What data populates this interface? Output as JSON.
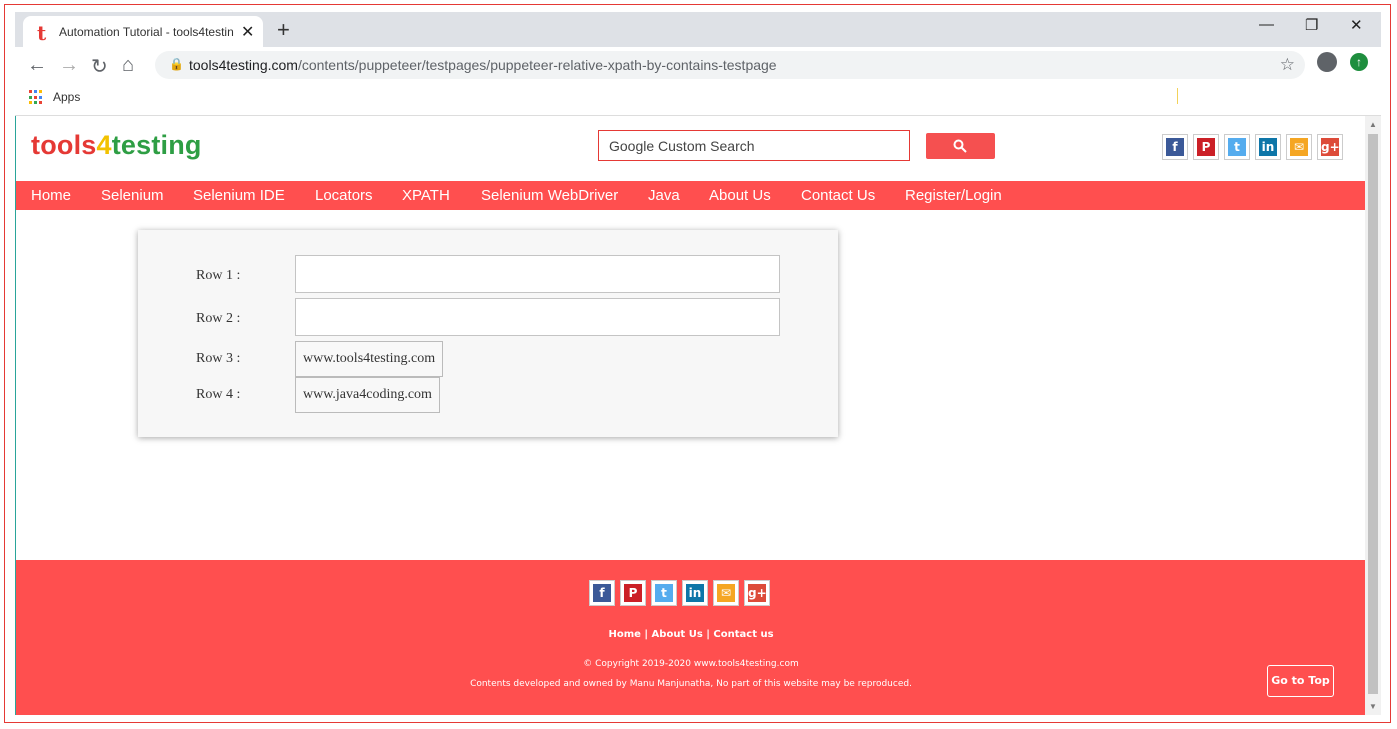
{
  "browser": {
    "tab_title": "Automation Tutorial - tools4testing",
    "tab_favicon": "t",
    "new_tab_icon": "+",
    "url_host": "tools4testing.com",
    "url_path": "/contents/puppeteer/testpages/puppeteer-relative-xpath-by-contains-testpage",
    "bookmarks": {
      "apps_label": "Apps"
    }
  },
  "site": {
    "logo": {
      "part1": "tools",
      "part2": "4",
      "part3": "testing"
    },
    "search": {
      "placeholder": "Google Custom Search"
    },
    "social": [
      {
        "name": "facebook-icon",
        "glyph": "f",
        "color": "#3b5998"
      },
      {
        "name": "pinterest-icon",
        "glyph": "P",
        "color": "#cb2027"
      },
      {
        "name": "twitter-icon",
        "glyph": "t",
        "color": "#55acee"
      },
      {
        "name": "linkedin-icon",
        "glyph": "in",
        "color": "#0e76a8"
      },
      {
        "name": "email-icon",
        "glyph": "✉",
        "color": "#f5a623"
      },
      {
        "name": "googleplus-icon",
        "glyph": "g+",
        "color": "#dd4b39"
      }
    ],
    "nav": [
      "Home",
      "Selenium",
      "Selenium IDE",
      "Locators",
      "XPATH",
      "Selenium WebDriver",
      "Java",
      "About Us",
      "Contact Us",
      "Register/Login"
    ]
  },
  "form": {
    "rows": [
      {
        "label": "Row 1 :",
        "value": ""
      },
      {
        "label": "Row 2 :",
        "value": ""
      },
      {
        "label": "Row 3 :",
        "button": "www.tools4testing.com"
      },
      {
        "label": "Row 4 :",
        "button": "www.java4coding.com"
      }
    ]
  },
  "footer": {
    "links": [
      "Home",
      "About Us",
      "Contact us"
    ],
    "copyright": "© Copyright 2019-2020 www.tools4testing.com",
    "ownership": "Contents developed and owned by Manu Manjunatha, No part of this website may be reproduced.",
    "go_top": "Go to Top"
  },
  "colors": {
    "brand_red": "#ff4f4f",
    "accent_yellow": "#f2c200",
    "accent_green": "#2e9e44"
  }
}
